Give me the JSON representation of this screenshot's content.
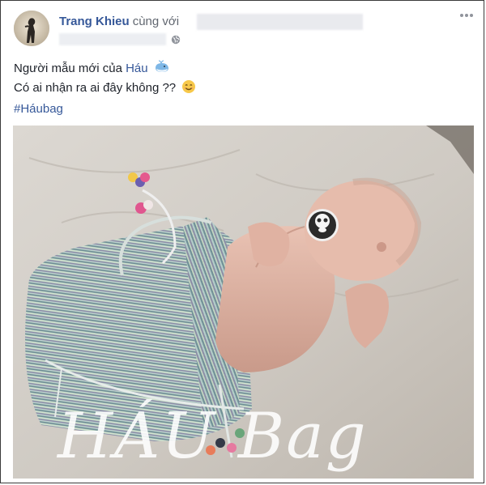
{
  "post": {
    "author_name": "Trang Khieu",
    "with_word": "cùng với",
    "line1_prefix": "Người mẫu mới của ",
    "line1_mention": "Háu",
    "line2": "Có ai nhận ra ai đây không ??",
    "hashtag": "#Háubag"
  },
  "icons": {
    "avatar": "avatar",
    "privacy": "globe-icon",
    "options": "more-options-icon",
    "mention_emoji": "whale-icon",
    "line2_emoji": "smiling-face-icon"
  },
  "colors": {
    "link": "#365899",
    "text": "#1d2129",
    "meta": "#616770",
    "frame": "#3a3a3a"
  },
  "photo": {
    "overlay_text": "HÁU Bag"
  }
}
